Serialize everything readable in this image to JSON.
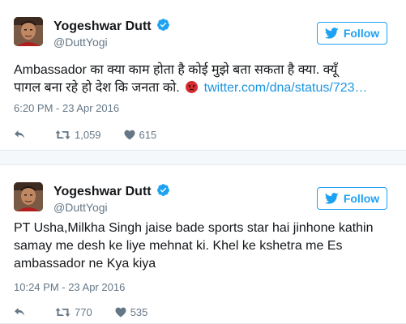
{
  "tweets": [
    {
      "name": "Yogeshwar Dutt",
      "handle": "@DuttYogi",
      "follow_label": "Follow",
      "text_line1": "Ambassador का क्या काम होता है कोई मुझे बता सकता है क्या. क्यूँ",
      "text_line2": "पागल बना रहे हो देश कि जनता को.",
      "link": "twitter.com/dna/status/723…",
      "timestamp": "6:20 PM - 23 Apr 2016",
      "retweets": "1,059",
      "likes": "615"
    },
    {
      "name": "Yogeshwar Dutt",
      "handle": "@DuttYogi",
      "follow_label": "Follow",
      "text_line1": "PT Usha,Milkha Singh jaise bade sports star hai jinhone kathin",
      "text_line2": "samay me desh ke liye mehnat ki. Khel ke kshetra me Es",
      "text_line3": "ambassador ne Kya kiya",
      "timestamp": "10:24 PM - 23 Apr 2016",
      "retweets": "770",
      "likes": "535"
    }
  ],
  "colors": {
    "brand_blue": "#1da1f2",
    "link_blue": "#1b95e0",
    "muted": "#657786",
    "text": "#14171a"
  },
  "icons": [
    "verified-badge-icon",
    "twitter-bird-icon",
    "reply-icon",
    "retweet-icon",
    "heart-icon",
    "angry-face-icon"
  ]
}
